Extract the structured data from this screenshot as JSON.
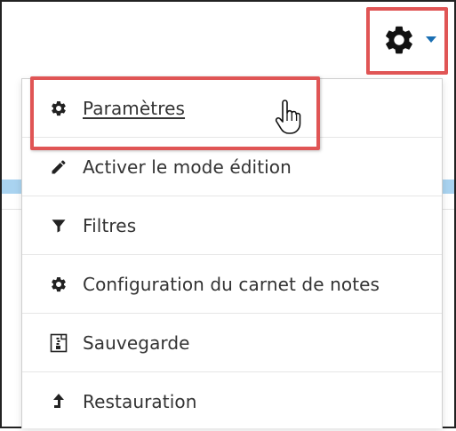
{
  "settings_menu": {
    "trigger_icon": "gear-icon",
    "caret_icon": "caret-down-icon",
    "caret_color": "#1a6fb3",
    "highlight_color": "#e05555",
    "items": [
      {
        "label": "Paramètres",
        "icon": "gear-icon",
        "active": true
      },
      {
        "label": "Activer le mode édition",
        "icon": "pencil-icon",
        "active": false
      },
      {
        "label": "Filtres",
        "icon": "filter-icon",
        "active": false
      },
      {
        "label": "Configuration du carnet de notes",
        "icon": "gear-icon",
        "active": false
      },
      {
        "label": "Sauvegarde",
        "icon": "backup-file-icon",
        "active": false
      },
      {
        "label": "Restauration",
        "icon": "restore-arrow-icon",
        "active": false
      }
    ]
  },
  "cursor": {
    "icon": "hand-pointer-cursor-icon"
  }
}
